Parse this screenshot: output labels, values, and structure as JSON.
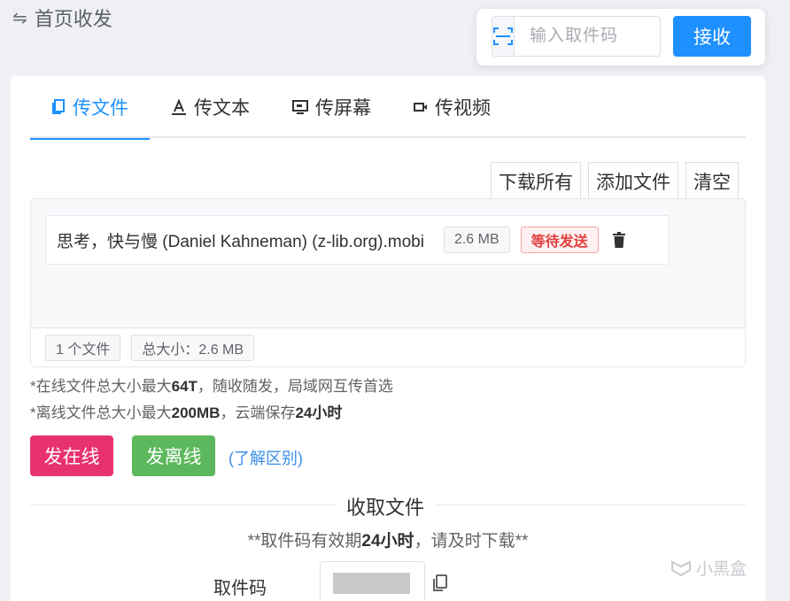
{
  "header": {
    "title": "首页收发",
    "icon": "swap-arrows-icon"
  },
  "receive": {
    "placeholder": "输入取件码",
    "button": "接收",
    "scan_icon": "scan-icon"
  },
  "tabs": [
    {
      "label": "传文件",
      "icon": "file-copy-icon",
      "active": true
    },
    {
      "label": "传文本",
      "icon": "text-icon",
      "active": false
    },
    {
      "label": "传屏幕",
      "icon": "screen-icon",
      "active": false
    },
    {
      "label": "传视频",
      "icon": "video-icon",
      "active": false
    }
  ],
  "file_actions": {
    "download_all": "下载所有",
    "add_file": "添加文件",
    "clear": "清空"
  },
  "files": [
    {
      "name": "思考，快与慢 (Daniel Kahneman) (z-lib.org).mobi",
      "size": "2.6 MB",
      "status": "等待发送"
    }
  ],
  "summary": {
    "count": "1 个文件",
    "total": "总大小：2.6 MB"
  },
  "notes": {
    "online_prefix": "*在线文件总大小最大",
    "online_bold": "64T",
    "online_suffix": "，随收随发，局域网互传首选",
    "offline_prefix": "*离线文件总大小最大",
    "offline_bold": "200MB",
    "offline_mid": "，云端保存",
    "offline_bold2": "24小时"
  },
  "send": {
    "online": "发在线",
    "offline": "发离线",
    "diff_link": "(了解区别)"
  },
  "pickup": {
    "title": "收取文件",
    "hint_prefix": "**取件码有效期",
    "hint_bold": "24小时",
    "hint_suffix": "，请及时下载**",
    "code_label": "取件码"
  },
  "watermark": "小黑盒",
  "colors": {
    "primary": "#1e90ff",
    "online": "#e8326d",
    "offline": "#5cb85c",
    "danger": "#e23f3f"
  }
}
